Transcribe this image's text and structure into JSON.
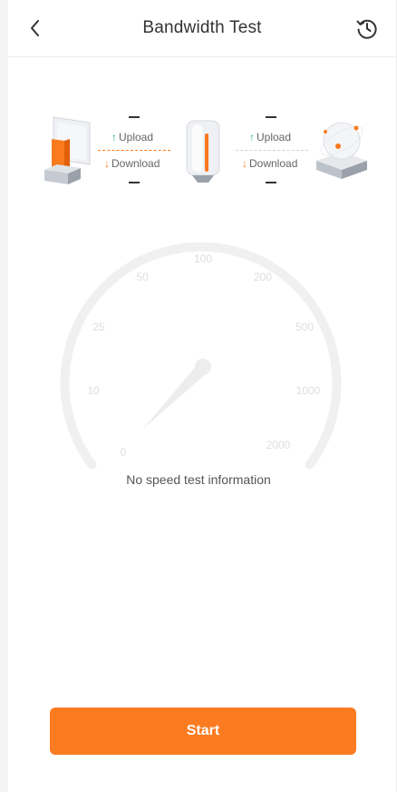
{
  "header": {
    "title": "Bandwidth Test"
  },
  "icons": {
    "back": "chevron-left-icon",
    "history": "history-icon"
  },
  "diagram": {
    "left_link": {
      "upload_label": "Upload",
      "download_label": "Download",
      "upload_value": "—",
      "download_value": "—"
    },
    "right_link": {
      "upload_label": "Upload",
      "download_label": "Download",
      "upload_value": "—",
      "download_value": "—"
    }
  },
  "gauge": {
    "ticks": [
      "0",
      "10",
      "25",
      "50",
      "100",
      "200",
      "500",
      "1000",
      "2000"
    ]
  },
  "status_text": "No speed test information",
  "start_label": "Start",
  "colors": {
    "accent": "#fb7b20",
    "upload": "#19b87c",
    "download": "#fa7a1e",
    "gauge_track": "#f0f0f0"
  }
}
